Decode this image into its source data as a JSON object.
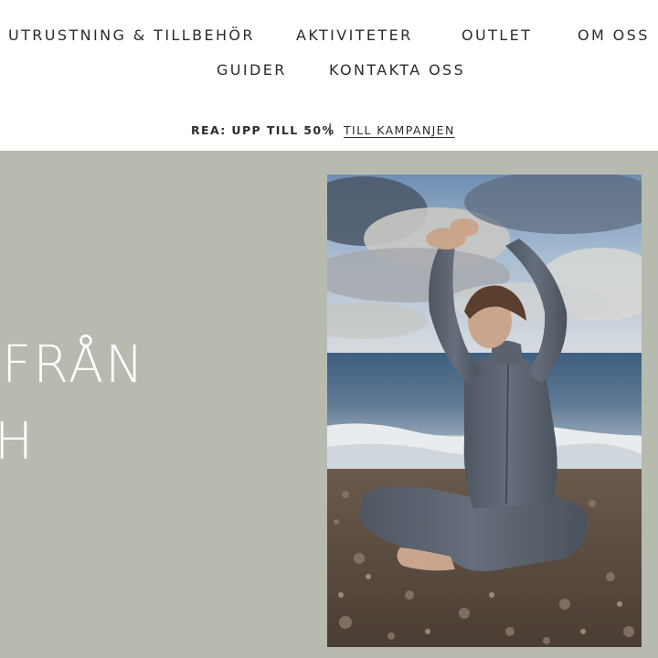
{
  "nav": {
    "items": [
      {
        "label": "UTRUSTNING & TILLBEHÖR"
      },
      {
        "label": "AKTIVITETER"
      },
      {
        "label": "OUTLET"
      },
      {
        "label": "OM OSS"
      },
      {
        "label": "GUIDER"
      },
      {
        "label": "KONTAKTA OSS"
      }
    ]
  },
  "promo": {
    "text": "REA: UPP TILL 50%",
    "separator": "|",
    "link_label": "TILL KAMPANJEN"
  },
  "hero": {
    "headline_line_1": "FRÅN",
    "headline_line_2": "H",
    "image_description_icon": "yoga-photo"
  },
  "colors": {
    "hero_background": "#b7baaf",
    "text": "#2b2b2b",
    "hero_text": "#ffffff"
  }
}
